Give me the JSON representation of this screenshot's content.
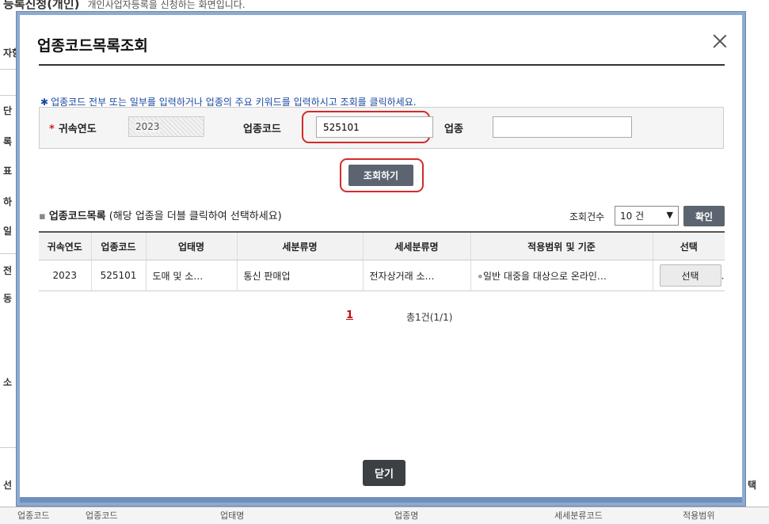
{
  "background": {
    "title": "등록신청(개인)",
    "subtitle": "개인사업자등록을 신청하는 화면입니다.",
    "side_labels": [
      "자항",
      "단",
      "록",
      "표",
      "하",
      "일",
      "전",
      "동",
      "소",
      "선"
    ],
    "right_label": "택",
    "bottom_cols": [
      "업종코드",
      "업종코드",
      "업태명",
      "업종명",
      "세세분류코드",
      "적용범위"
    ]
  },
  "modal": {
    "title": "업종코드목록조회",
    "guide": "업종코드 전부 또는 일부를 입력하거나 업종의 주요 키워드를 입력하시고 조회를 클릭하세요.",
    "search": {
      "year_label": "귀속연도",
      "year_value": "2023",
      "code_label": "업종코드",
      "code_value": "525101",
      "biz_label": "업종",
      "biz_value": "",
      "search_button": "조회하기"
    },
    "list": {
      "title_bold": "업종코드목록",
      "title_note": "(해당 업종을 더블 클릭하여 선택하세요)",
      "count_label": "조회건수",
      "count_value": "10 건",
      "ok_button": "확인",
      "columns": [
        "귀속연도",
        "업종코드",
        "업태명",
        "세분류명",
        "세세분류명",
        "적용범위 및 기준",
        "선택"
      ],
      "rows": [
        {
          "year": "2023",
          "code": "525101",
          "category": "도매 및 소…",
          "sub": "통신 판매업",
          "subsub": "전자상거래 소…",
          "scope": "∘일반 대중을 대상으로 온라인…",
          "select": "선택"
        }
      ]
    },
    "pager": {
      "current": "1",
      "total": "총1건(1/1)"
    },
    "close_button": "닫기"
  }
}
